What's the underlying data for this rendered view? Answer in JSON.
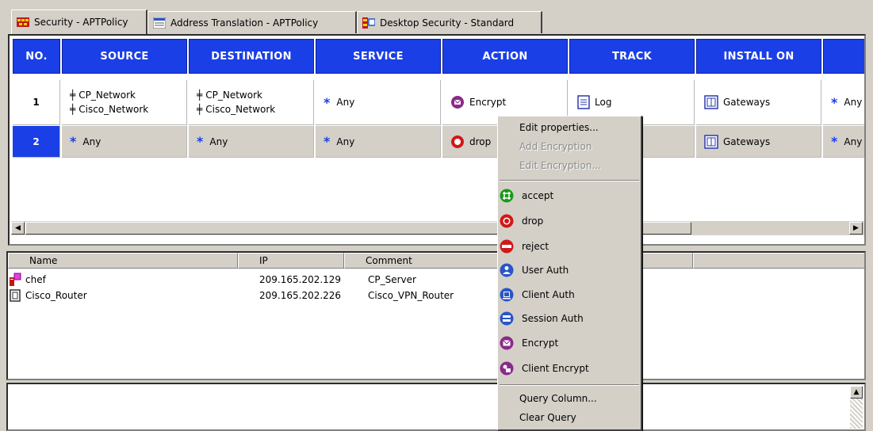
{
  "tabs": [
    {
      "label": "Security - APTPolicy",
      "active": true
    },
    {
      "label": "Address Translation - APTPolicy",
      "active": false
    },
    {
      "label": "Desktop Security - Standard",
      "active": false
    }
  ],
  "columns": [
    "NO.",
    "SOURCE",
    "DESTINATION",
    "SERVICE",
    "ACTION",
    "TRACK",
    "INSTALL ON"
  ],
  "rules": [
    {
      "no": "1",
      "source": [
        "CP_Network",
        "Cisco_Network"
      ],
      "destination": [
        "CP_Network",
        "Cisco_Network"
      ],
      "service": "Any",
      "action": "Encrypt",
      "track": "Log",
      "install_on": "Gateways",
      "extra": "Any"
    },
    {
      "no": "2",
      "source": "Any",
      "destination": "Any",
      "service": "Any",
      "action": "drop",
      "install_on": "Gateways",
      "extra": "Any"
    }
  ],
  "object_list": {
    "headers": [
      "Name",
      "IP",
      "Comment"
    ],
    "rows": [
      {
        "name": "chef",
        "ip": "209.165.202.129",
        "comment": "CP_Server"
      },
      {
        "name": "Cisco_Router",
        "ip": "209.165.202.226",
        "comment": "Cisco_VPN_Router"
      }
    ]
  },
  "context_menu": {
    "top_items": [
      {
        "label": "Edit properties...",
        "enabled": true
      },
      {
        "label": "Add Encryption",
        "enabled": false
      },
      {
        "label": "Edit Encryption...",
        "enabled": false
      }
    ],
    "actions": [
      {
        "label": "accept",
        "icon": "accept-icon",
        "color": "#1a9a1a"
      },
      {
        "label": "drop",
        "icon": "drop-icon",
        "color": "#d01818"
      },
      {
        "label": "reject",
        "icon": "reject-icon",
        "color": "#d01818"
      },
      {
        "label": "User Auth",
        "icon": "user-auth-icon",
        "color": "#2a55c8"
      },
      {
        "label": "Client Auth",
        "icon": "client-auth-icon",
        "color": "#2a55c8"
      },
      {
        "label": "Session Auth",
        "icon": "session-auth-icon",
        "color": "#2a55c8"
      },
      {
        "label": "Encrypt",
        "icon": "encrypt-icon",
        "color": "#8a2a8a"
      },
      {
        "label": "Client Encrypt",
        "icon": "client-encrypt-icon",
        "color": "#8a2a8a"
      }
    ],
    "bottom_items": [
      {
        "label": "Query Column..."
      },
      {
        "label": "Clear Query"
      }
    ]
  },
  "colors": {
    "header_blue": "#1b3fe6",
    "window_gray": "#d4d0c8"
  }
}
